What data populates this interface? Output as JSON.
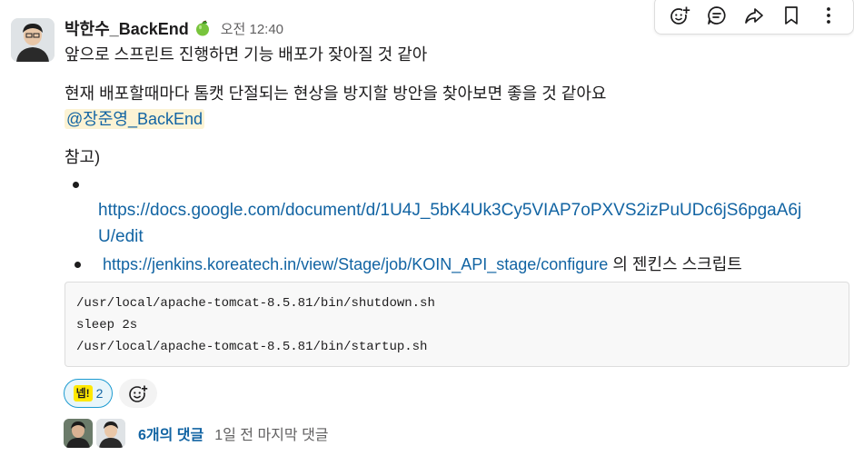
{
  "message": {
    "author": "박한수_BackEnd",
    "timestamp": "오전 12:40",
    "line1": "앞으로 스프린트 진행하면 기능 배포가 잦아질 것 같아",
    "line2": "현재 배포할때마다 톰캣 단절되는 현상을 방지할 방안을 찾아보면 좋을 것 같아요",
    "mention": "@장준영_BackEnd",
    "reference_label": "참고)",
    "link1_part1": "https://docs.google.com/document/d/1U4J_5bK4Uk3Cy5VIAP7oPXVS2izPuUDc6jS6pgaA6j",
    "link1_part2": "U/edit",
    "link2": "https://jenkins.koreatech.in/view/Stage/job/KOIN_API_stage/configure",
    "link2_suffix": "의 젠킨스 스크립트",
    "code_lines": [
      "/usr/local/apache-tomcat-8.5.81/bin/shutdown.sh",
      "sleep 2s",
      "/usr/local/apache-tomcat-8.5.81/bin/startup.sh"
    ]
  },
  "reaction": {
    "emoji_text": "넵!",
    "count": "2"
  },
  "thread": {
    "replies": "6개의 댓글",
    "last_reply": "1일 전 마지막 댓글"
  },
  "colors": {
    "link": "#1264a3",
    "mention_bg": "#fcf3d4",
    "reaction_border": "#1d9bd1"
  },
  "icons": [
    "add-reaction-icon",
    "reply-thread-icon",
    "share-icon",
    "bookmark-icon",
    "more-actions-icon",
    "apple-status-icon"
  ]
}
